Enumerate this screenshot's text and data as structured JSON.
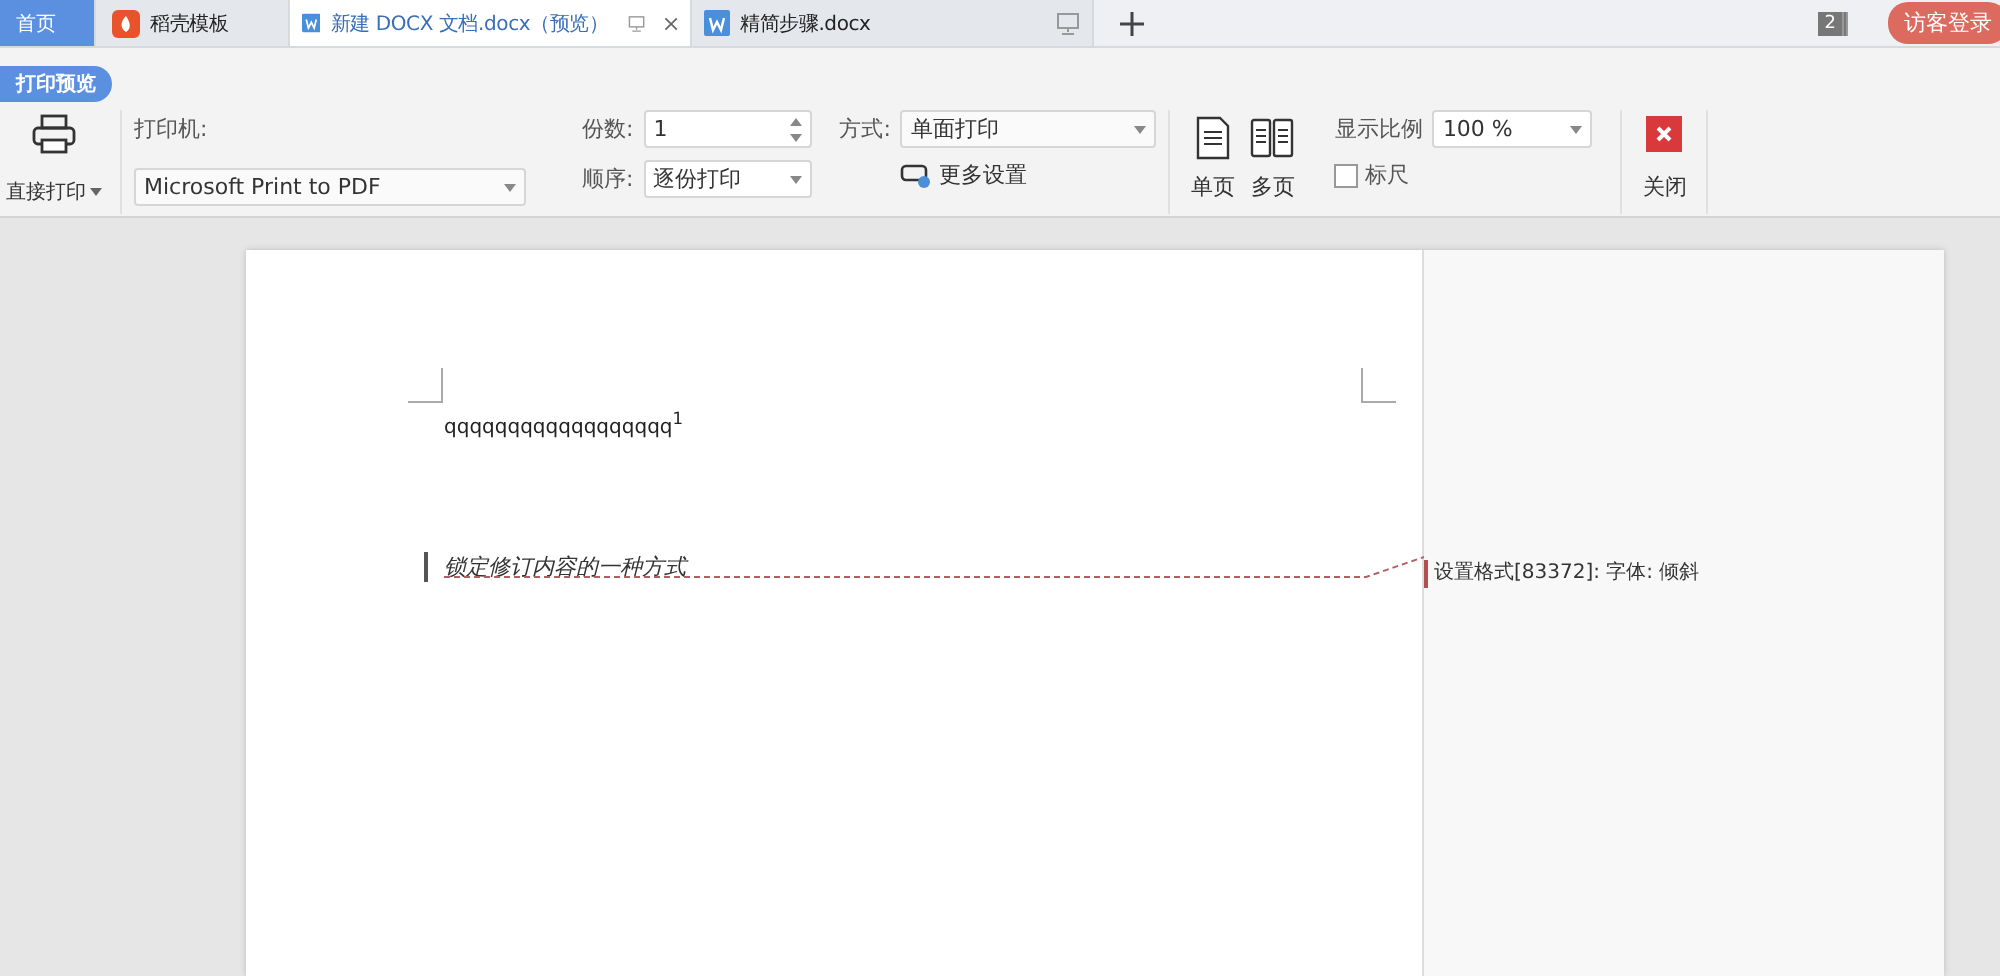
{
  "tabs": [
    {
      "kind": "home",
      "label": "首页",
      "selected": false
    },
    {
      "kind": "template",
      "label": "稻壳模板",
      "selected": false
    },
    {
      "kind": "doc",
      "label": "新建 DOCX 文档.docx（预览）",
      "selected": true,
      "closable": true
    },
    {
      "kind": "doc",
      "label": "精简步骤.docx",
      "selected": false,
      "closable": false
    }
  ],
  "window_count": "2",
  "login_button": "访客登录",
  "mode_label": "打印预览",
  "toolbar": {
    "direct_print": "直接打印",
    "printer_label": "打印机:",
    "printer": "Microsoft Print to PDF",
    "copies_label": "份数:",
    "copies": "1",
    "order_label": "顺序:",
    "order": "逐份打印",
    "method_label": "方式:",
    "method": "单面打印",
    "more_settings": "更多设置",
    "single_page": "单页",
    "multi_page": "多页",
    "zoom_label": "显示比例",
    "zoom": "100 %",
    "ruler": {
      "label": "标尺",
      "checked": false
    },
    "close": "关闭"
  },
  "document": {
    "line_1": "qqqqqqqqqqqqqqqqqq$^{1}$",
    "line_2": "锁定修订内容的一种方式",
    "comment": "设置格式[83372]: 字体: 倾斜"
  }
}
